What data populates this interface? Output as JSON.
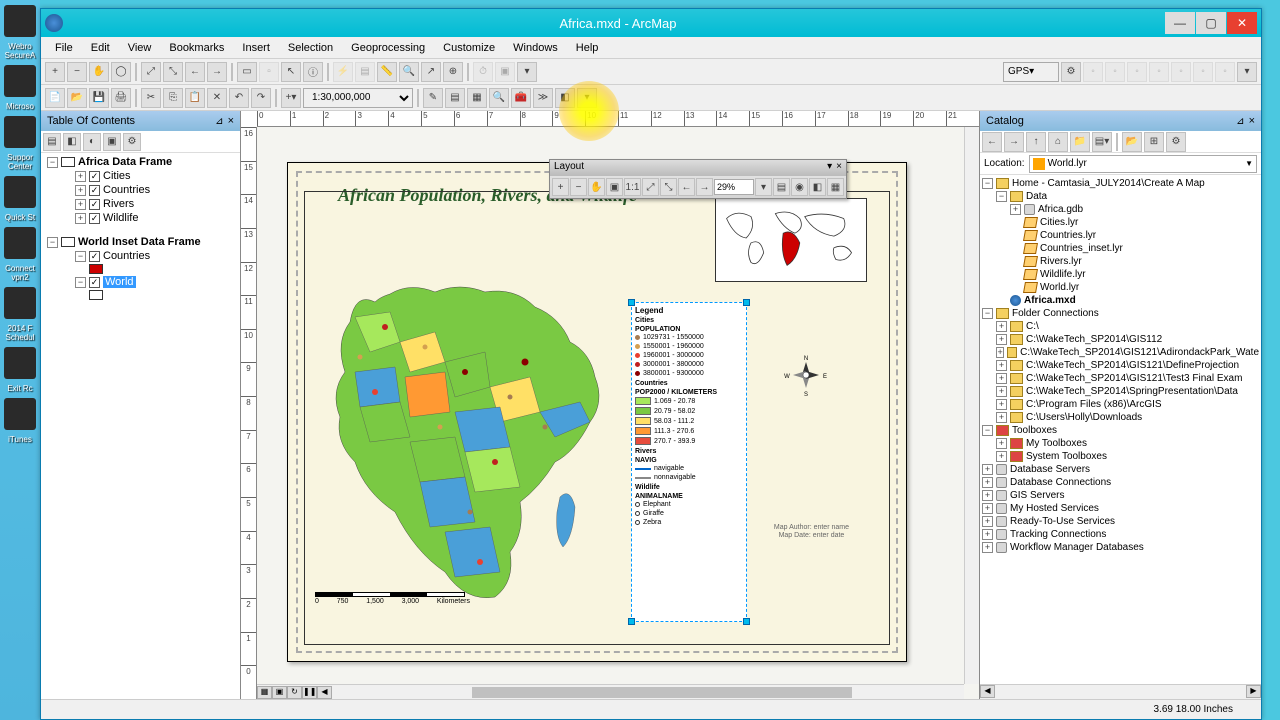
{
  "window": {
    "title": "Africa.mxd - ArcMap"
  },
  "menu": [
    "File",
    "Edit",
    "View",
    "Bookmarks",
    "Insert",
    "Selection",
    "Geoprocessing",
    "Customize",
    "Windows",
    "Help"
  ],
  "scale": "1:30,000,000",
  "gps_label": "GPS",
  "toc": {
    "title": "Table Of Contents",
    "frame1": "Africa Data Frame",
    "layers1": [
      "Cities",
      "Countries",
      "Rivers",
      "Wildlife"
    ],
    "frame2": "World Inset Data Frame",
    "layers2a": "Countries",
    "layers2b": "World"
  },
  "catalog": {
    "title": "Catalog",
    "location_label": "Location:",
    "location_value": "World.lyr",
    "root": "Home - Camtasia_JULY2014\\Create A Map",
    "data_folder": "Data",
    "gdb": "Africa.gdb",
    "lyrs": [
      "Cities.lyr",
      "Countries.lyr",
      "Countries_inset.lyr",
      "Rivers.lyr",
      "Wildlife.lyr",
      "World.lyr"
    ],
    "mxd": "Africa.mxd",
    "folder_conn": "Folder Connections",
    "folders": [
      "C:\\",
      "C:\\WakeTech_SP2014\\GIS112",
      "C:\\WakeTech_SP2014\\GIS121\\AdirondackPark_Wate",
      "C:\\WakeTech_SP2014\\GIS121\\DefineProjection",
      "C:\\WakeTech_SP2014\\GIS121\\Test3 Final Exam",
      "C:\\WakeTech_SP2014\\SpringPresentation\\Data",
      "C:\\Program Files (x86)\\ArcGIS",
      "C:\\Users\\Holly\\Downloads"
    ],
    "toolboxes": "Toolboxes",
    "tb_items": [
      "My Toolboxes",
      "System Toolboxes"
    ],
    "rest": [
      "Database Servers",
      "Database Connections",
      "GIS Servers",
      "My Hosted Services",
      "Ready-To-Use Services",
      "Tracking Connections",
      "Workflow Manager Databases"
    ]
  },
  "layout_toolbar": {
    "title": "Layout",
    "zoom": "29%"
  },
  "map": {
    "title": "African Population, Rivers, and Wildlife",
    "author": "Map Author: enter name",
    "date": "Map Date: enter date",
    "scalebar": {
      "v0": "0",
      "v1": "750",
      "v2": "1,500",
      "v3": "3,000",
      "unit": "Kilometers"
    }
  },
  "legend": {
    "title": "Legend",
    "cities": "Cities",
    "population": "POPULATION",
    "pop_classes": [
      "1029731 - 1550000",
      "1550001 - 1960000",
      "1960001 - 3000000",
      "3000001 - 3800000",
      "3800001 - 9300000"
    ],
    "countries": "Countries",
    "pop2000": "POP2000 / KILOMETERS",
    "country_classes": [
      "1.069 - 20.78",
      "20.79 - 58.02",
      "58.03 - 111.2",
      "111.3 - 270.6",
      "270.7 - 393.9"
    ],
    "rivers": "Rivers",
    "navig": "NAVIG",
    "river_classes": [
      "navigable",
      "nonnavigable"
    ],
    "wildlife": "Wildlife",
    "animalname": "ANIMALNAME",
    "animals": [
      "Elephant",
      "Giraffe",
      "Zebra"
    ]
  },
  "ruler_h": [
    "0",
    "1",
    "2",
    "3",
    "4",
    "5",
    "6",
    "7",
    "8",
    "9",
    "10",
    "11",
    "12",
    "13",
    "14",
    "15",
    "16",
    "17",
    "18",
    "19",
    "20",
    "21"
  ],
  "ruler_v": [
    "16",
    "15",
    "14",
    "13",
    "12",
    "11",
    "10",
    "9",
    "8",
    "7",
    "6",
    "5",
    "4",
    "3",
    "2",
    "1",
    "0"
  ],
  "status": {
    "coord": "3.69   18.00 Inches"
  },
  "colors": {
    "country_ramp": [
      "#a6e85c",
      "#7ac943",
      "#ffe066",
      "#ff9933",
      "#e74c3c"
    ],
    "pop_dots": [
      "#a67c52",
      "#d4a050",
      "#e84030",
      "#c02020",
      "#8b0000"
    ]
  },
  "desktop": [
    "Webro",
    "SecureA",
    "",
    "Microso",
    "",
    "Suppor",
    "Center",
    "",
    "Quick St",
    "",
    "",
    "Connect",
    "vpn2",
    "",
    "",
    "2014 F",
    "Schedul",
    "",
    "",
    "Exit Rc",
    "",
    "",
    "iTunes"
  ]
}
